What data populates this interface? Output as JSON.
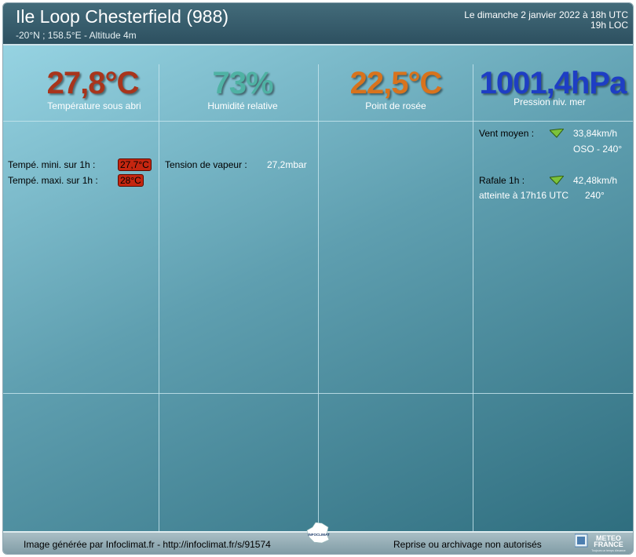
{
  "header": {
    "station": "Ile Loop Chesterfield  (988)",
    "coords": "-20°N ; 158.5°E - Altitude 4m",
    "date_utc": "Le dimanche 2 janvier 2022 à 18h UTC",
    "date_loc": "19h LOC"
  },
  "metrics": {
    "temperature": {
      "value": "27,8°C",
      "label": "Température sous abri",
      "color": "#a8351c"
    },
    "humidity": {
      "value": "73%",
      "label": "Humidité relative",
      "color": "#4fb2a4"
    },
    "dewpoint": {
      "value": "22,5°C",
      "label": "Point de rosée",
      "color": "#d8731d"
    },
    "pressure": {
      "value": "1001,4hPa",
      "label": "Pression niv. mer",
      "color": "#1e3ec4"
    }
  },
  "temp_details": {
    "min_label": "Tempé. mini. sur 1h :",
    "min_value": "27,7°C",
    "max_label": "Tempé. maxi. sur 1h :",
    "max_value": "28°C"
  },
  "vapor": {
    "label": "Tension de vapeur :",
    "value": "27,2mbar"
  },
  "wind": {
    "label": "Vent moyen :",
    "speed": "33,84km/h",
    "direction": "OSO - 240°",
    "gust_label": "Rafale 1h :",
    "gust_speed": "42,48km/h",
    "gust_time": "atteinte à 17h16 UTC",
    "gust_direction": "240°",
    "arrow_icon": "wind-arrow-icon"
  },
  "footer": {
    "left": "Image générée par Infoclimat.fr - http://infoclimat.fr/s/91574",
    "right": "Reprise ou archivage non autorisés",
    "infoclimat_logo": "INFOCLIMAT",
    "meteofrance_logo_line1": "METEO",
    "meteofrance_logo_line2": "FRANCE",
    "meteofrance_tagline": "Toujours un temps d'avance"
  }
}
